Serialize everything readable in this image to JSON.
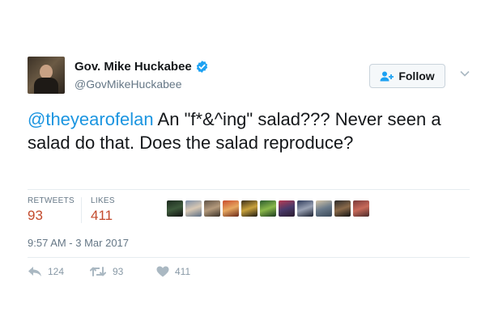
{
  "author": {
    "display_name": "Gov. Mike Huckabee",
    "handle": "@GovMikeHuckabee",
    "verified": true
  },
  "follow_label": "Follow",
  "tweet": {
    "mention": "@theyearofelan",
    "text": " An \"f*&^ing\" salad???  Never seen a salad do that. Does the salad reproduce?"
  },
  "stats": {
    "retweets_label": "RETWEETS",
    "retweets_value": "93",
    "likes_label": "LIKES",
    "likes_value": "411"
  },
  "liker_avatar_count_shown": 11,
  "timestamp": "9:57 AM - 3 Mar 2017",
  "actions": {
    "reply_count": "124",
    "retweet_count": "93",
    "like_count": "411"
  },
  "colors": {
    "mention": "#1b95e0",
    "stat_value": "#c34a2c",
    "verified": "#1da1f2",
    "muted": "#657786"
  },
  "icons": {
    "verified": "verified-badge-icon",
    "follow": "add-user-icon",
    "caret": "chevron-down-icon",
    "reply": "reply-icon",
    "retweet": "retweet-icon",
    "like": "heart-icon"
  }
}
